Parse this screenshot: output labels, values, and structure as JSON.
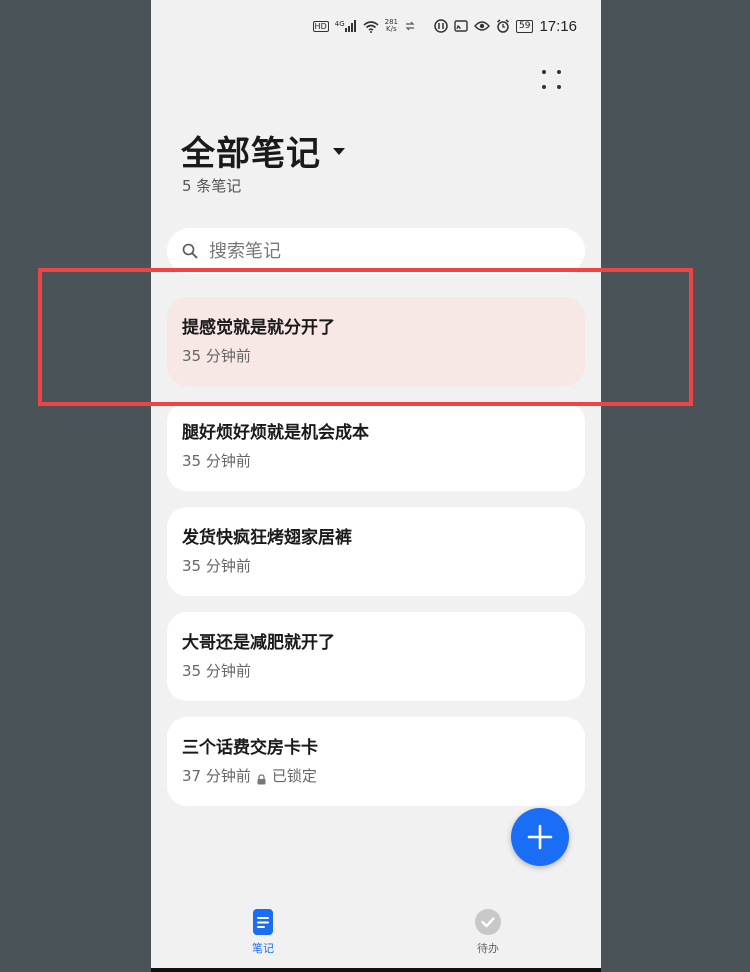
{
  "status_bar": {
    "hd": "HD",
    "signal": "4G",
    "speed_value": "281",
    "speed_unit": "K/s",
    "battery": "59",
    "time": "17:16"
  },
  "header": {
    "title": "全部笔记",
    "count": "5 条笔记"
  },
  "search": {
    "placeholder": "搜索笔记"
  },
  "notes": [
    {
      "title": "提感觉就是就分开了",
      "time": "35 分钟前",
      "locked": false
    },
    {
      "title": "腿好烦好烦就是机会成本",
      "time": "35 分钟前",
      "locked": false
    },
    {
      "title": "发货快疯狂烤翅家居裤",
      "time": "35 分钟前",
      "locked": false
    },
    {
      "title": "大哥还是减肥就开了",
      "time": "35 分钟前",
      "locked": false
    },
    {
      "title": "三个话费交房卡卡",
      "time": "37 分钟前",
      "locked": true,
      "lock_label": "已锁定"
    }
  ],
  "tabs": {
    "notes_label": "笔记",
    "todo_label": "待办"
  },
  "colors": {
    "accent": "#1a6ef5",
    "selected_card": "#f7e8e6",
    "highlight": "#ee4444"
  }
}
